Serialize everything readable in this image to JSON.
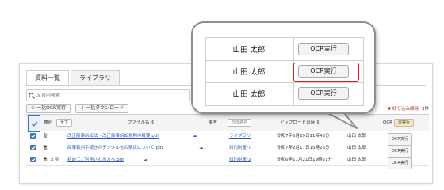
{
  "tabs": [
    {
      "label": "資料一覧"
    },
    {
      "label": "ライブラリ"
    }
  ],
  "search": {
    "placeholder": "文書内検索"
  },
  "toolbar": {
    "bulk_ocr": "一括OCR実行",
    "bulk_download": "一括ダウンロード"
  },
  "filter": {
    "reset_label": "絞り込み解除",
    "count": "3件"
  },
  "table": {
    "headers": {
      "type": "種別",
      "type_filter": "全て",
      "filename": "ファイル名 ⇕",
      "note": "備考",
      "owner_placeholder": "作成者名",
      "upload_date": "アップロード日時 ⇕",
      "ocr": "OCR",
      "ocr_filter": "未実行"
    },
    "rows": [
      {
        "type": "",
        "filename": "改正民事訴訟法・改正民事訴訟規則の概要.pdf",
        "owner": "ライブラリ",
        "date": "令和7年5月29日11時43分",
        "uploader": "山田 太郎",
        "ocr": "OCR実行"
      },
      {
        "type": "",
        "filename": "民事裁判手続きのデジタル化の現状について.pdf",
        "owner": "知的財産/7",
        "date": "令和7年2月17日15時25分",
        "uploader": "山田 太郎",
        "ocr": "OCR実行"
      },
      {
        "type": "文渉",
        "filename": "初めてご利用される方へ.pdf",
        "owner": "知的財産/3",
        "date": "令和6年11月21日19時21分",
        "uploader": "山田 太郎",
        "ocr": "OCR実行"
      }
    ]
  },
  "zoom": {
    "rows": [
      {
        "name": "山田 太郎",
        "button": "OCR実行"
      },
      {
        "name": "山田 太郎",
        "button": "OCR実行"
      },
      {
        "name": "山田 太郎",
        "button": "OCR実行"
      }
    ]
  },
  "colors": {
    "accent": "#3d73c7",
    "link": "#2c5bb8",
    "highlight": "#d81c1c",
    "filter_badge": "#fbe7b5"
  }
}
